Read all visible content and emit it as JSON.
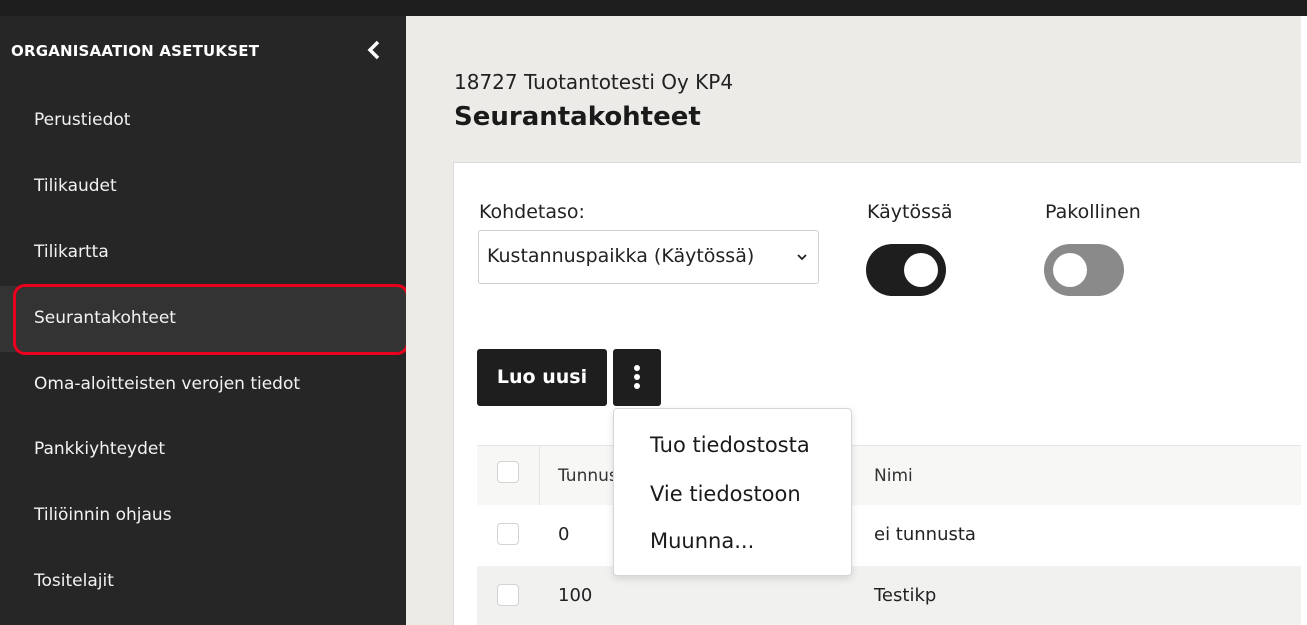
{
  "sidebar": {
    "title": "ORGANISAATION ASETUKSET",
    "items": [
      {
        "label": "Perustiedot"
      },
      {
        "label": "Tilikaudet"
      },
      {
        "label": "Tilikartta"
      },
      {
        "label": "Seurantakohteet",
        "active": true
      },
      {
        "label": "Oma-aloitteisten verojen tiedot"
      },
      {
        "label": "Pankkiyhteydet"
      },
      {
        "label": "Tiliöinnin ohjaus"
      },
      {
        "label": "Tositelajit"
      }
    ],
    "collapse_icon": "chevron-left-icon"
  },
  "header": {
    "organization": "18727 Tuotantotesti Oy KP4",
    "title": "Seurantakohteet"
  },
  "filters": {
    "kohdetaso_label": "Kohdetaso:",
    "kohdetaso_value": "Kustannuspaikka (Käytössä)",
    "kaytossa_label": "Käytössä",
    "kaytossa_on": true,
    "pakollinen_label": "Pakollinen",
    "pakollinen_on": false
  },
  "toolbar": {
    "create_label": "Luo uusi",
    "more_icon": "vertical-ellipsis-icon"
  },
  "menu": {
    "items": [
      "Tuo tiedostosta",
      "Vie tiedostoon",
      "Muunna..."
    ]
  },
  "table": {
    "columns": [
      "Tunnus",
      "Nimi"
    ],
    "rows": [
      {
        "tunnus": "0",
        "nimi": "ei tunnusta"
      },
      {
        "tunnus": "100",
        "nimi": "Testikp"
      }
    ]
  },
  "colors": {
    "sidebar_bg": "#262626",
    "highlight": "#e8001c",
    "main_bg": "#ecebe8",
    "dark_button": "#1e1e1e"
  }
}
